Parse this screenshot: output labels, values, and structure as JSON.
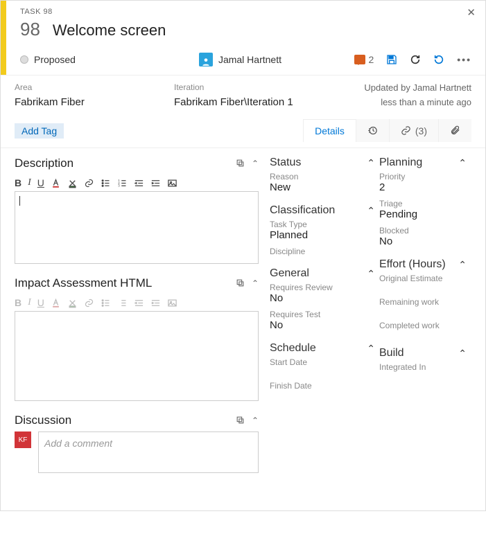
{
  "header": {
    "task_label": "TASK 98",
    "id": "98",
    "title": "Welcome screen",
    "state": "Proposed",
    "assignee": "Jamal Hartnett",
    "comment_count": "2"
  },
  "info": {
    "area_label": "Area",
    "area_value": "Fabrikam Fiber",
    "iteration_label": "Iteration",
    "iteration_value": "Fabrikam Fiber\\Iteration 1",
    "updated_by": "Updated by Jamal Hartnett",
    "updated_time": "less than a minute ago"
  },
  "tags": {
    "add_label": "Add Tag"
  },
  "tabs": {
    "details": "Details",
    "links_count": "(3)"
  },
  "sections": {
    "description": "Description",
    "impact": "Impact Assessment HTML",
    "discussion": "Discussion",
    "comment_placeholder": "Add a comment",
    "user_initials": "KF"
  },
  "status": {
    "title": "Status",
    "reason_label": "Reason",
    "reason_value": "New"
  },
  "classification": {
    "title": "Classification",
    "tasktype_label": "Task Type",
    "tasktype_value": "Planned",
    "discipline_label": "Discipline"
  },
  "general": {
    "title": "General",
    "review_label": "Requires Review",
    "review_value": "No",
    "test_label": "Requires Test",
    "test_value": "No"
  },
  "schedule": {
    "title": "Schedule",
    "start_label": "Start Date",
    "finish_label": "Finish Date"
  },
  "planning": {
    "title": "Planning",
    "priority_label": "Priority",
    "priority_value": "2",
    "triage_label": "Triage",
    "triage_value": "Pending",
    "blocked_label": "Blocked",
    "blocked_value": "No"
  },
  "effort": {
    "title": "Effort (Hours)",
    "orig_label": "Original Estimate",
    "remaining_label": "Remaining work",
    "completed_label": "Completed work"
  },
  "build": {
    "title": "Build",
    "integrated_label": "Integrated In"
  }
}
